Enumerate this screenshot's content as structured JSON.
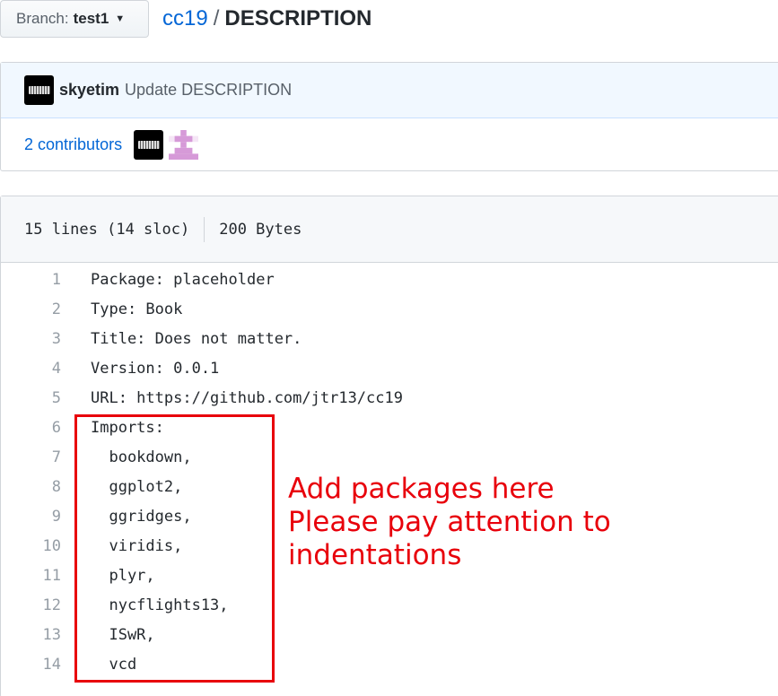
{
  "branch": {
    "label": "Branch:",
    "name": "test1",
    "icon": "caret-down-icon"
  },
  "breadcrumb": {
    "repo": "cc19",
    "separator": "/",
    "file": "DESCRIPTION"
  },
  "commit": {
    "author": "skyetim",
    "message": "Update DESCRIPTION"
  },
  "contributors": {
    "count": "2",
    "label": "contributors"
  },
  "file": {
    "lines": "15 lines (14 sloc)",
    "size": "200 Bytes"
  },
  "code_lines": [
    {
      "n": "1",
      "text": "Package: placeholder"
    },
    {
      "n": "2",
      "text": "Type: Book"
    },
    {
      "n": "3",
      "text": "Title: Does not matter."
    },
    {
      "n": "4",
      "text": "Version: 0.0.1"
    },
    {
      "n": "5",
      "text": "URL: https://github.com/jtr13/cc19"
    },
    {
      "n": "6",
      "text": "Imports:"
    },
    {
      "n": "7",
      "text": "  bookdown,"
    },
    {
      "n": "8",
      "text": "  ggplot2,"
    },
    {
      "n": "9",
      "text": "  ggridges,"
    },
    {
      "n": "10",
      "text": "  viridis,"
    },
    {
      "n": "11",
      "text": "  plyr,"
    },
    {
      "n": "12",
      "text": "  nycflights13,"
    },
    {
      "n": "13",
      "text": "  ISwR,"
    },
    {
      "n": "14",
      "text": "  vcd"
    }
  ],
  "annotation": {
    "line1": "Add packages here",
    "line2": "Please pay attention to indentations",
    "color": "#e8000b"
  }
}
